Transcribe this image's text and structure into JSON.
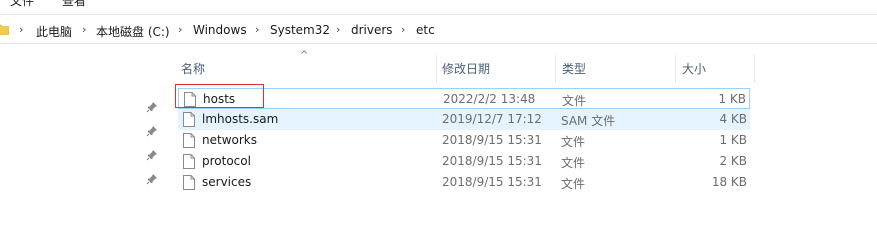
{
  "toolbar": {
    "menu_1": "文件",
    "menu_2": "查看"
  },
  "breadcrumb": {
    "items": [
      "此电脑",
      "本地磁盘 (C:)",
      "Windows",
      "System32",
      "drivers",
      "etc"
    ]
  },
  "columns": {
    "name": "名称",
    "date": "修改日期",
    "type": "类型",
    "size": "大小"
  },
  "files": [
    {
      "name": "hosts",
      "date": "2022/2/2 13:48",
      "type": "文件",
      "size": "1 KB"
    },
    {
      "name": "lmhosts.sam",
      "date": "2019/12/7 17:12",
      "type": "SAM 文件",
      "size": "4 KB"
    },
    {
      "name": "networks",
      "date": "2018/9/15 15:31",
      "type": "文件",
      "size": "1 KB"
    },
    {
      "name": "protocol",
      "date": "2018/9/15 15:31",
      "type": "文件",
      "size": "2 KB"
    },
    {
      "name": "services",
      "date": "2018/9/15 15:31",
      "type": "文件",
      "size": "18 KB"
    }
  ],
  "colors": {
    "hover_bg": "#e5f3ff",
    "selected_border": "#99d1ff",
    "highlight": "#d9342b",
    "header_text": "#4c607a"
  }
}
